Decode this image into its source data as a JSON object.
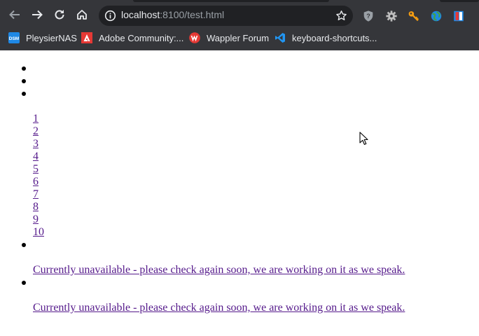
{
  "browser": {
    "url_host": "localhost",
    "url_rest": ":8100/test.html",
    "bookmarks": [
      {
        "label": "PleysierNAS",
        "icon": "dsm-icon",
        "icon_text": "DSM",
        "color": "#1e88e5"
      },
      {
        "label": "Adobe Community:...",
        "icon": "adobe-icon",
        "color": "#e53935"
      },
      {
        "label": "Wappler Forum",
        "icon": "wappler-icon",
        "color": "#e53935"
      },
      {
        "label": "keyboard-shortcuts...",
        "icon": "vscode-icon",
        "color": "#2196f3"
      }
    ]
  },
  "page": {
    "pager_numbers": [
      "1",
      "2",
      "3",
      "4",
      "5",
      "6",
      "7",
      "8",
      "9",
      "10"
    ],
    "messages": [
      "Currently unavailable - please check again soon, we are working on it as we speak.",
      "Currently unavailable - please check again soon, we are working on it as we speak."
    ]
  }
}
